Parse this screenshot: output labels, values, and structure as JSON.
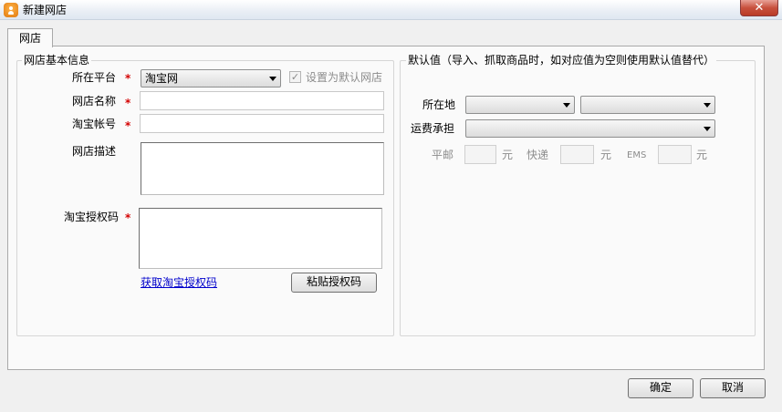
{
  "window": {
    "title": "新建网店",
    "close_label": "✕"
  },
  "tabs": [
    {
      "label": "网店"
    }
  ],
  "basic_group": {
    "title": "网店基本信息",
    "platform": {
      "label": "所在平台",
      "required": "*",
      "value": "淘宝网"
    },
    "set_default": {
      "label": "设置为默认网店",
      "checked": true,
      "mark": "✓"
    },
    "shop_name": {
      "label": "网店名称",
      "required": "*",
      "value": ""
    },
    "shop_account": {
      "label": "淘宝帐号",
      "required": "*",
      "value": ""
    },
    "shop_desc": {
      "label": "网店描述",
      "value": ""
    },
    "auth_code": {
      "label": "淘宝授权码",
      "required": "*",
      "value": ""
    },
    "get_auth_link": "获取淘宝授权码",
    "paste_auth_button": "粘贴授权码"
  },
  "defaults_group": {
    "title": "默认值（导入、抓取商品时，如对应值为空则使用默认值替代）",
    "location": {
      "label": "所在地",
      "province": "",
      "city": ""
    },
    "freight": {
      "label": "运费承担",
      "value": ""
    },
    "shipping": {
      "regular": {
        "label": "平邮",
        "value": "",
        "unit": "元"
      },
      "express": {
        "label": "快递",
        "value": "",
        "unit": "元"
      },
      "ems": {
        "label": "EMS",
        "value": "",
        "unit": "元"
      }
    }
  },
  "footer": {
    "ok_label": "确定",
    "cancel_label": "取消"
  }
}
